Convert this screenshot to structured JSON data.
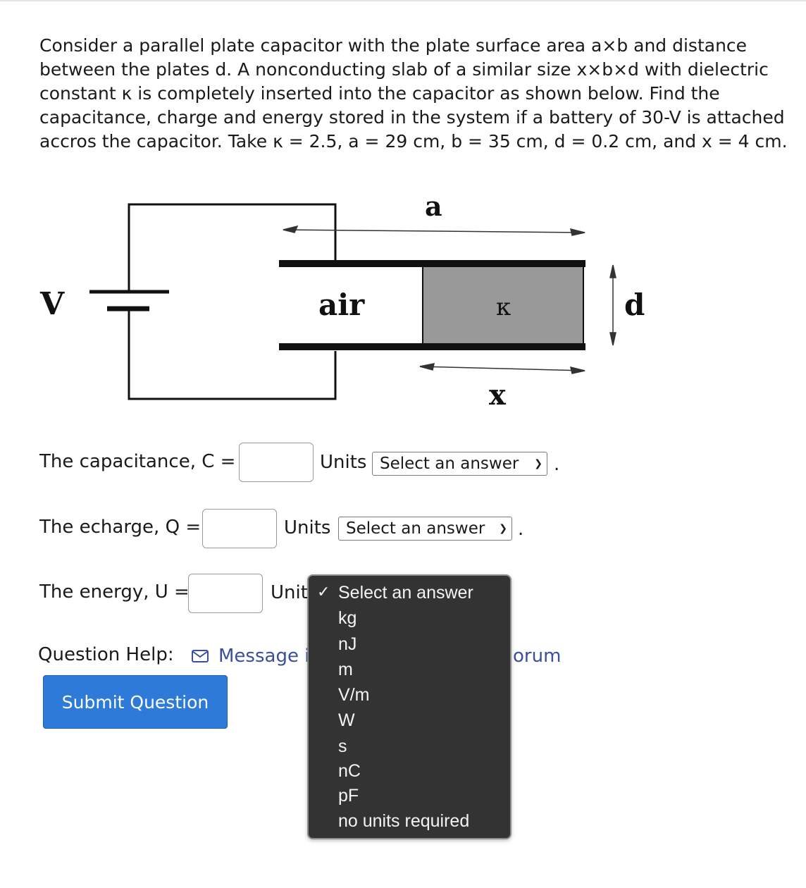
{
  "problem": {
    "text": "Consider a parallel plate capacitor with the plate surface area a×b and distance between the plates d. A nonconducting slab of a similar size x×b×d with dielectric constant κ is completely inserted into the capacitor as shown below. Find the capacitance, charge and energy stored in the system if a battery of 30-V is attached accros the capacitor. Take κ = 2.5, a = 29 cm, b = 35 cm, d = 0.2 cm, and x = 4 cm."
  },
  "figure": {
    "label_V": "V",
    "label_a": "a",
    "label_air": "air",
    "label_kappa": "κ",
    "label_d": "d",
    "label_x": "x",
    "colors": {
      "dielectric": "#999999",
      "plate": "#111111",
      "wire": "#111111"
    }
  },
  "questions": {
    "capacitance": {
      "label": "The capacitance, C =",
      "value": "",
      "units_label": "Units",
      "units_selected": "Select an answer"
    },
    "charge": {
      "label": "The echarge, Q =",
      "value": "",
      "units_label": "Units",
      "units_selected": "Select an answer"
    },
    "energy": {
      "label": "The energy, U =",
      "value": "",
      "units_label": "Unit"
    }
  },
  "period": ".",
  "help": {
    "label": "Question Help:",
    "message_link": "Message i",
    "forum_link": "orum"
  },
  "submit": {
    "label": "Submit Question"
  },
  "dropdown": {
    "check_glyph": "✓",
    "options": [
      "Select an answer",
      "kg",
      "nJ",
      "m",
      "V/m",
      "W",
      "s",
      "nC",
      "pF",
      "no units required"
    ],
    "colors": {
      "background": "#333333",
      "text": "#f4f4f4"
    }
  }
}
